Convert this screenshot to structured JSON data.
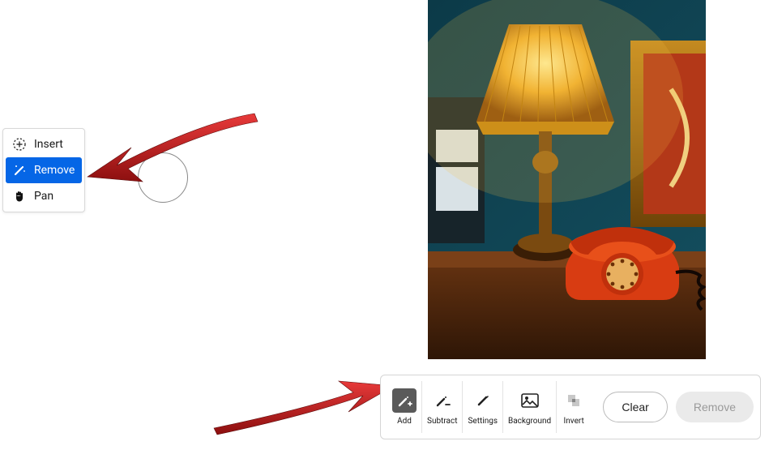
{
  "leftPanel": {
    "insert_label": "Insert",
    "remove_label": "Remove",
    "pan_label": "Pan"
  },
  "bottomBar": {
    "add_label": "Add",
    "subtract_label": "Subtract",
    "settings_label": "Settings",
    "background_label": "Background",
    "invert_label": "Invert",
    "clear_label": "Clear",
    "remove_label": "Remove"
  },
  "icons": {
    "insert": "insert-dashed-circle",
    "remove": "magic-wand",
    "pan": "hand"
  },
  "colors": {
    "accent": "#0566e6",
    "arrow": "#c41f1f"
  }
}
